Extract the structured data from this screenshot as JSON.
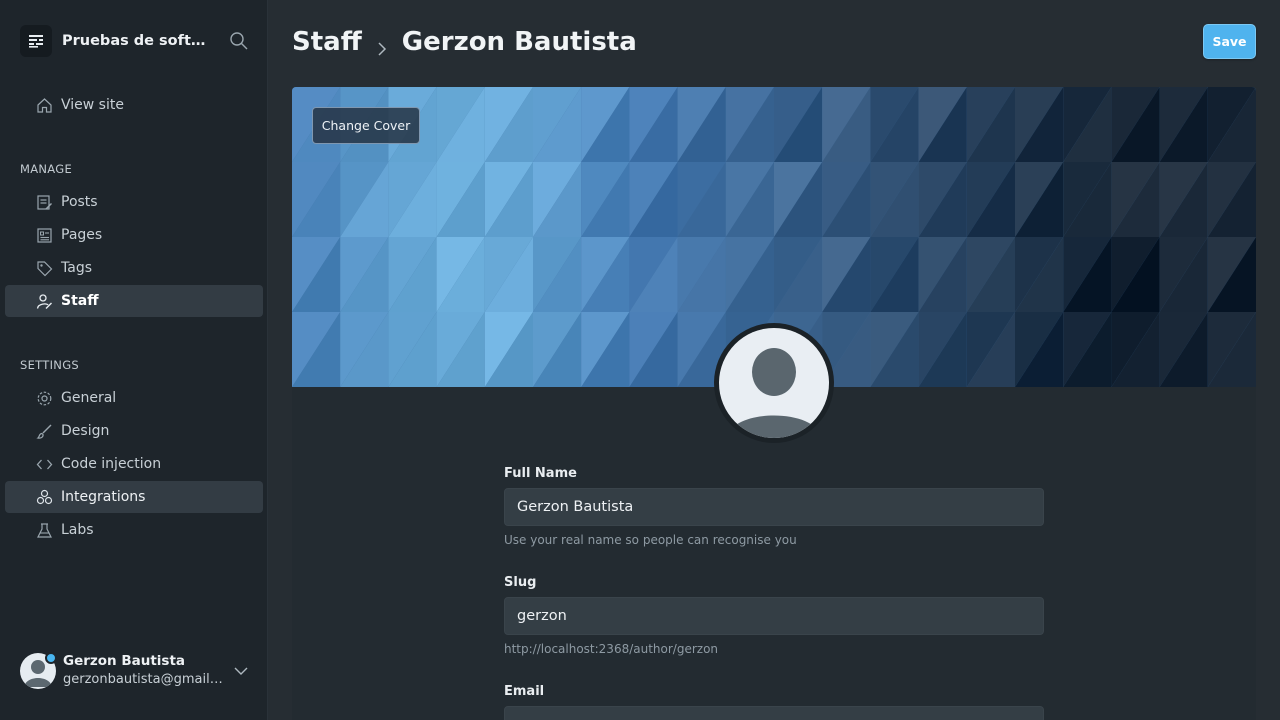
{
  "sidebar": {
    "site_title": "Pruebas de software",
    "view_site": "View site",
    "manage_title": "MANAGE",
    "manage_items": [
      {
        "label": "Posts",
        "icon": "posts-icon"
      },
      {
        "label": "Pages",
        "icon": "pages-icon"
      },
      {
        "label": "Tags",
        "icon": "tag-icon"
      },
      {
        "label": "Staff",
        "icon": "staff-icon",
        "active": true
      }
    ],
    "settings_title": "SETTINGS",
    "settings_items": [
      {
        "label": "General",
        "icon": "gear-icon"
      },
      {
        "label": "Design",
        "icon": "brush-icon"
      },
      {
        "label": "Code injection",
        "icon": "code-icon"
      },
      {
        "label": "Integrations",
        "icon": "integrations-icon",
        "hover": true
      },
      {
        "label": "Labs",
        "icon": "flask-icon"
      }
    ],
    "user": {
      "name": "Gerzon Bautista",
      "email": "gerzonbautista@gmail.com"
    }
  },
  "header": {
    "section": "Staff",
    "current": "Gerzon Bautista",
    "save_label": "Save"
  },
  "cover": {
    "change_cover_label": "Change Cover"
  },
  "form": {
    "full_name": {
      "label": "Full Name",
      "value": "Gerzon Bautista",
      "help": "Use your real name so people can recognise you"
    },
    "slug": {
      "label": "Slug",
      "value": "gerzon",
      "help": "http://localhost:2368/author/gerzon"
    },
    "email": {
      "label": "Email"
    }
  },
  "colors": {
    "accent": "#4fb3ee",
    "sidebar_bg": "#1e252b",
    "main_bg": "#262d33",
    "panel_bg": "#232b31"
  }
}
